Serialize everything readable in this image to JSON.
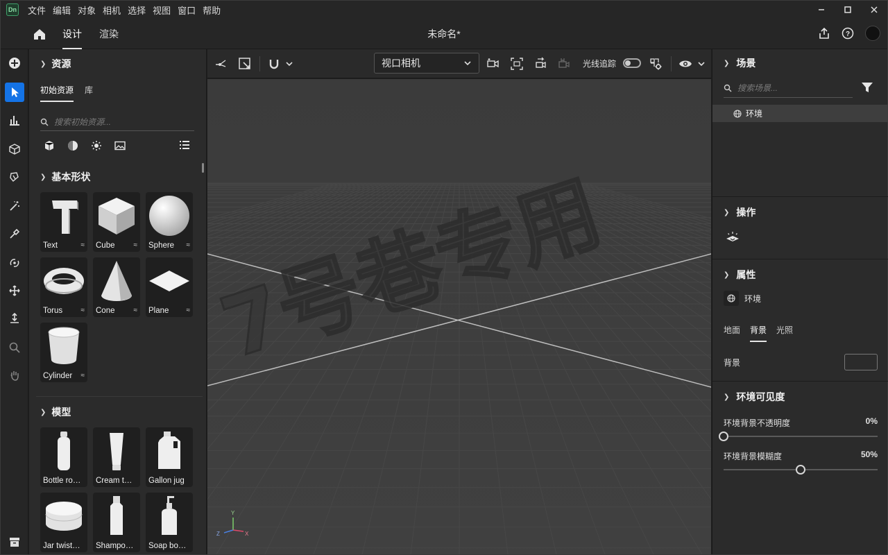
{
  "titlebar": {
    "logo": "Dn",
    "menu": [
      "文件",
      "编辑",
      "对象",
      "相机",
      "选择",
      "视图",
      "窗口",
      "帮助"
    ]
  },
  "header": {
    "tabs": [
      "设计",
      "渲染"
    ],
    "active_tab": "设计",
    "doc_title": "未命名*"
  },
  "assets": {
    "title": "资源",
    "subtabs": [
      "初始资源",
      "库"
    ],
    "search_placeholder": "搜索初始资源...",
    "basic_shapes_title": "基本形状",
    "basic_shapes": [
      "Text",
      "Cube",
      "Sphere",
      "Torus",
      "Cone",
      "Plane",
      "Cylinder"
    ],
    "models_title": "模型",
    "models": [
      "Bottle ro…",
      "Cream tu…",
      "Gallon jug",
      "Jar twist …",
      "Shampo…",
      "Soap bot…"
    ]
  },
  "viewport": {
    "camera": "视口相机",
    "raytrace_label": "光线追踪",
    "watermark": "7号巷专用",
    "axes": {
      "y": "Y",
      "z": "Z",
      "x": "X"
    }
  },
  "right": {
    "scene_title": "场景",
    "scene_search_placeholder": "搜索场景...",
    "scene_item": "环境",
    "actions_title": "操作",
    "props_title": "属性",
    "props_item": "环境",
    "prop_tabs": [
      "地面",
      "背景",
      "光照"
    ],
    "active_prop_tab": "背景",
    "bg_label": "背景",
    "visibility_title": "环境可见度",
    "opacity_label": "环境背景不透明度",
    "opacity_value": "0%",
    "opacity_level": 0,
    "blur_label": "环境背景模糊度",
    "blur_value": "50%",
    "blur_level": 0.5
  },
  "colors": {
    "accent": "#1473e6",
    "panel": "#2b2b2b",
    "viewport": "#3d3d3d"
  }
}
